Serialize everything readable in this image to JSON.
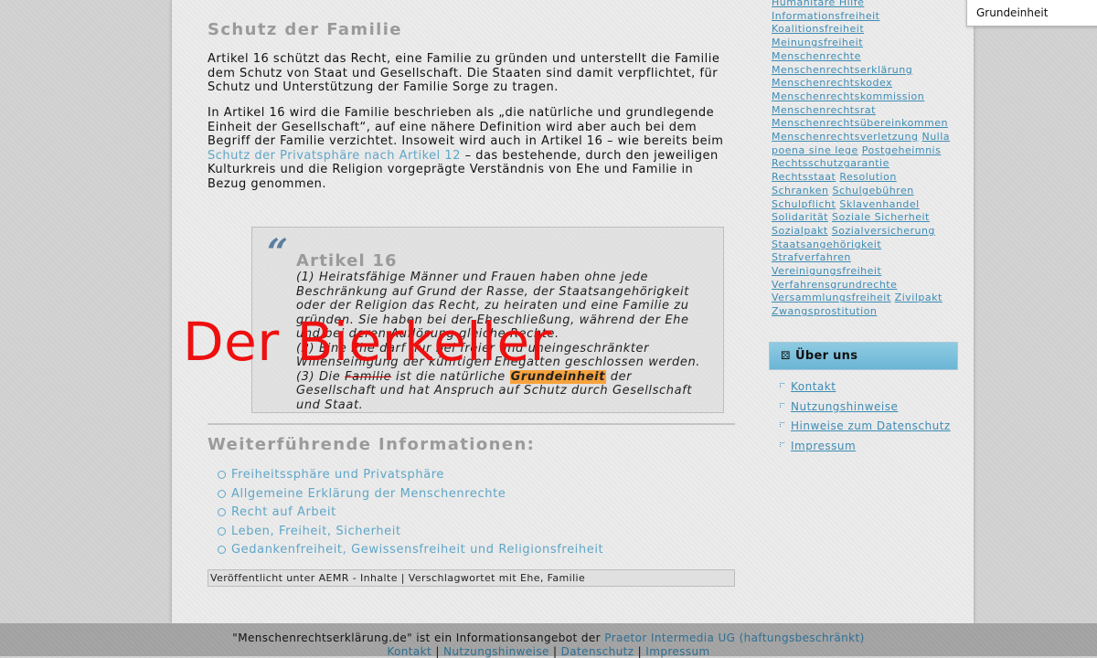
{
  "main": {
    "heading": "Schutz der Familie",
    "para1": "Artikel 16 schützt das Recht, eine Familie zu gründen und unterstellt die Familie dem Schutz von Staat und Gesellschaft. Die Staaten sind damit verpflichtet, für Schutz und Unterstützung der Familie Sorge zu tragen.",
    "para2_a": "In Artikel 16 wird die Familie beschrieben als „die natürliche und grundlegende Einheit der Gesellschaft“, auf eine nähere Definition wird aber auch bei dem Begriff der Familie verzichtet. Insoweit wird auch in Artikel 16 – wie bereits beim ",
    "para2_link": "Schutz der Privatsphäre nach Artikel 12",
    "para2_b": " – das bestehende, durch den jeweiligen Kulturkreis und die Religion vorgeprägte Verständnis von Ehe und Familie in Bezug genommen.",
    "quote": {
      "mark": "“",
      "title": "Artikel 16",
      "p1": "(1) Heiratsfähige Männer und Frauen haben ohne jede Beschränkung auf Grund der Rasse, der Staatsangehörigkeit oder der Religion das Recht, zu heiraten und eine Familie zu gründen. Sie haben bei der Eheschließung, während der Ehe und bei deren Auflösung gleiche Rechte.",
      "p2": "(2) Eine Ehe darf nur bei freier und uneingeschränkter Willenseinigung der künftigen Ehegatten geschlossen werden.",
      "p3_a": "(3) Die ",
      "p3_strike": "Familie",
      "p3_b": " ist die natürliche ",
      "p3_highlight": "Grundeinheit",
      "p3_c": " der Gesellschaft und hat Anspruch auf Schutz durch Gesellschaft und Staat."
    },
    "more_heading": "Weiterführende Informationen:",
    "more_links": [
      "Freiheitssphäre und Privatsphäre",
      "Allgemeine Erklärung der Menschenrechte",
      "Recht auf Arbeit",
      "Leben, Freiheit, Sicherheit",
      "Gedankenfreiheit, Gewissensfreiheit und Religionsfreiheit"
    ],
    "published": "Veröffentlicht unter AEMR - Inhalte | Verschlagwortet mit Ehe, Familie"
  },
  "sidebar": {
    "tags": [
      "Humanitäre Hilfe",
      "Informationsfreiheit",
      "Koalitionsfreiheit",
      "Meinungsfreiheit",
      "Menschenrechte",
      "Menschenrechtserklärung",
      "Menschenrechtskodex",
      "Menschenrechtskommission",
      "Menschenrechtsrat",
      "Menschenrechtsübereinkommen",
      "Menschenrechtsverletzung",
      "Nulla poena sine lege",
      "Postgeheimnis",
      "Rechtsschutzgarantie",
      "Rechtsstaat",
      "Resolution",
      "Schranken",
      "Schulgebühren",
      "Schulpflicht",
      "Sklavenhandel",
      "Solidarität",
      "Soziale Sicherheit",
      "Sozialpakt",
      "Sozialversicherung",
      "Staatsangehörigkeit",
      "Strafverfahren",
      "Vereinigungsfreiheit",
      "Verfahrensgrundrechte",
      "Versammlungsfreiheit",
      "Zivilpakt",
      "Zwangsprostitution"
    ],
    "uber_title": "Über uns",
    "uber_links": [
      "Kontakt",
      "Nutzungshinweise",
      "Hinweise zum Datenschutz",
      "Impressum"
    ]
  },
  "overlay_label": "Der Bierkeller",
  "search": {
    "value": "Grundeinheit"
  },
  "footer": {
    "text": "\"Menschenrechtserklärung.de\" ist ein Informationsangebot der ",
    "company": "Praetor Intermedia UG (haftungsbeschränkt)",
    "links": [
      "Kontakt",
      "Nutzungshinweise",
      "Datenschutz",
      "Impressum"
    ],
    "separator": " | "
  },
  "colors": {
    "link": "#5fa6c7",
    "tag_link": "#3d8cb5",
    "highlight": "#f7a23c",
    "overlay": "#ee1010",
    "uber_bar": "#7dc0dc"
  }
}
